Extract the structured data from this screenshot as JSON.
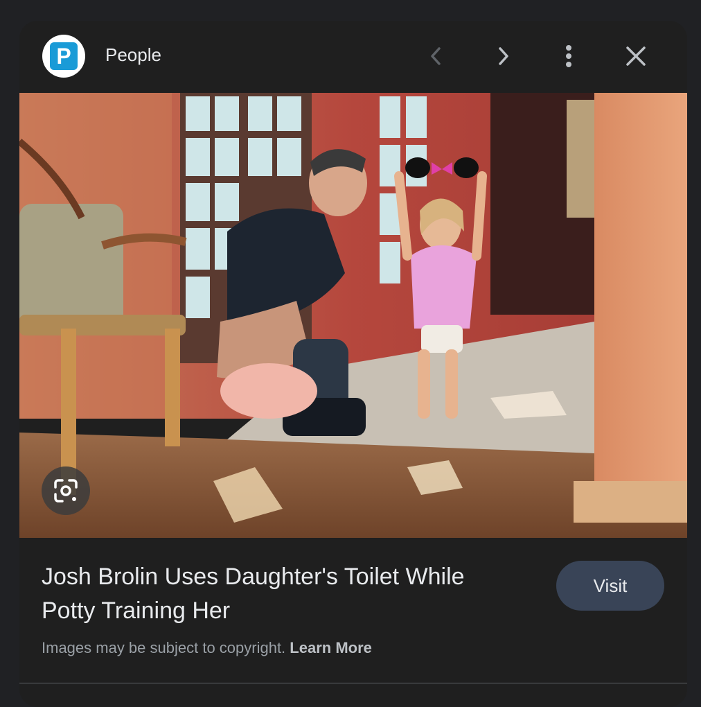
{
  "header": {
    "source_logo_letter": "P",
    "source_name": "People",
    "prev_icon": "chevron-left-icon",
    "next_icon": "chevron-right-icon",
    "more_icon": "more-vert-icon",
    "close_icon": "close-icon"
  },
  "main": {
    "image_description_icon": "lens-icon",
    "title": "Josh Brolin Uses Daughter's Toilet While Potty Training Her",
    "visit_label": "Visit",
    "copyright_text": "Images may be subject to copyright.",
    "learn_more": "Learn More"
  },
  "colors": {
    "background": "#202124",
    "panel": "#1f1f1f",
    "visit_button": "#394457",
    "brand_logo": "#1a9bd7"
  }
}
